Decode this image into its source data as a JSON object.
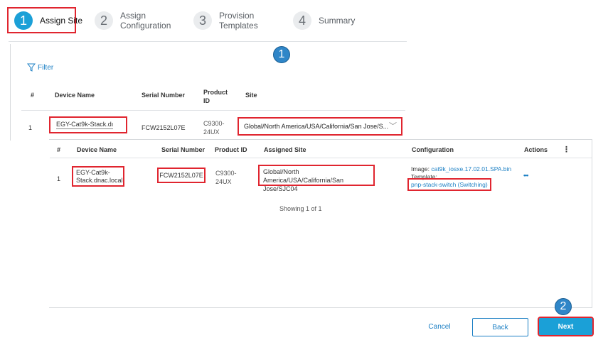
{
  "steps": [
    {
      "num": "1",
      "label": "Assign Site"
    },
    {
      "num": "2",
      "label_line1": "Assign",
      "label_line2": "Configuration"
    },
    {
      "num": "3",
      "label_line1": "Provision",
      "label_line2": "Templates"
    },
    {
      "num": "4",
      "label": "Summary"
    }
  ],
  "callouts": {
    "one": "1",
    "two": "2"
  },
  "filter": {
    "label": "Filter"
  },
  "site_table": {
    "headers": {
      "num": "#",
      "device_name": "Device Name",
      "serial": "Serial Number",
      "product_line1": "Product",
      "product_line2": "ID",
      "site": "Site"
    },
    "row": {
      "num": "1",
      "device_name": "EGY-Cat9k-Stack.dı",
      "serial": "FCW2152L07E",
      "product_line1": "C9300-",
      "product_line2": "24UX",
      "site": "Global/North America/USA/California/San Jose/S..."
    }
  },
  "summary_table": {
    "headers": {
      "num": "#",
      "device_name": "Device Name",
      "serial": "Serial Number",
      "product": "Product ID",
      "assigned_site": "Assigned Site",
      "configuration": "Configuration",
      "actions": "Actions",
      "more": "⋮"
    },
    "row": {
      "num": "1",
      "device_line1": "EGY-Cat9k-",
      "device_line2": "Stack.dnac.local",
      "serial": "FCW2152L07E",
      "product_line1": "C9300-",
      "product_line2": "24UX",
      "site_line1": "Global/North America/USA/California/San",
      "site_line2": "Jose/SJC04",
      "image_label": "Image:",
      "image_value": "cat9k_iosxe.17.02.01.SPA.bin",
      "template_label": "Template:",
      "template_value": "pnp-stack-switch (Switching)",
      "actions": "•••"
    },
    "footer": "Showing 1 of 1"
  },
  "footer_buttons": {
    "cancel": "Cancel",
    "back": "Back",
    "next": "Next"
  },
  "colors": {
    "accent": "#1ba0d7",
    "highlight": "#e0252f",
    "callout": "#2f86c8"
  }
}
